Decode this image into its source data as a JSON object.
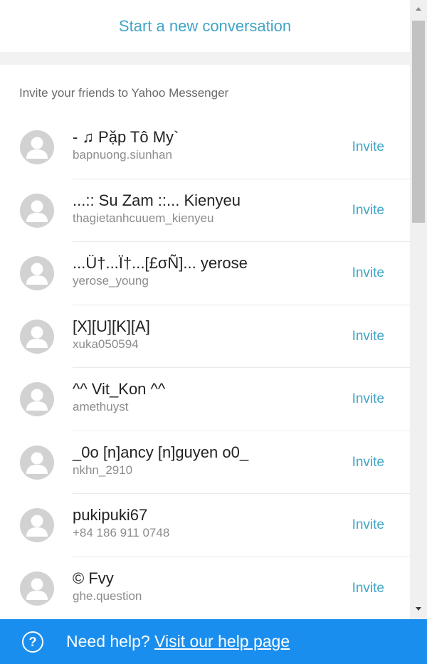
{
  "header": {
    "new_conversation_label": "Start a new conversation"
  },
  "invite_section": {
    "title": "Invite your friends to Yahoo Messenger",
    "contacts": [
      {
        "name": "- ♫ Pặp Tô My`",
        "id": "bapnuong.siunhan",
        "action": "Invite"
      },
      {
        "name": "...:: Su Zam ::... Kienyeu",
        "id": "thagietanhcuuem_kienyeu",
        "action": "Invite"
      },
      {
        "name": "...Ü†...Ï†...[£σÑ]... yerose",
        "id": "yerose_young",
        "action": "Invite"
      },
      {
        "name": "[X][U][K][A]",
        "id": "xuka050594",
        "action": "Invite"
      },
      {
        "name": "^^ Vit_Kon ^^",
        "id": "amethuyst",
        "action": "Invite"
      },
      {
        "name": "_0o [n]ancy [n]guyen o0_",
        "id": "nkhn_2910",
        "action": "Invite"
      },
      {
        "name": "pukipuki67",
        "id": "+84 186 911 0748",
        "action": "Invite"
      },
      {
        "name": "© Fvy",
        "id": "ghe.question",
        "action": "Invite"
      }
    ]
  },
  "help_bar": {
    "icon": "question-circle-icon",
    "prefix": "Need help? ",
    "link_label": "Visit our help page"
  },
  "colors": {
    "accent": "#3fa5c6",
    "help_bar": "#1a8eee",
    "background": "#f2f2f2"
  }
}
